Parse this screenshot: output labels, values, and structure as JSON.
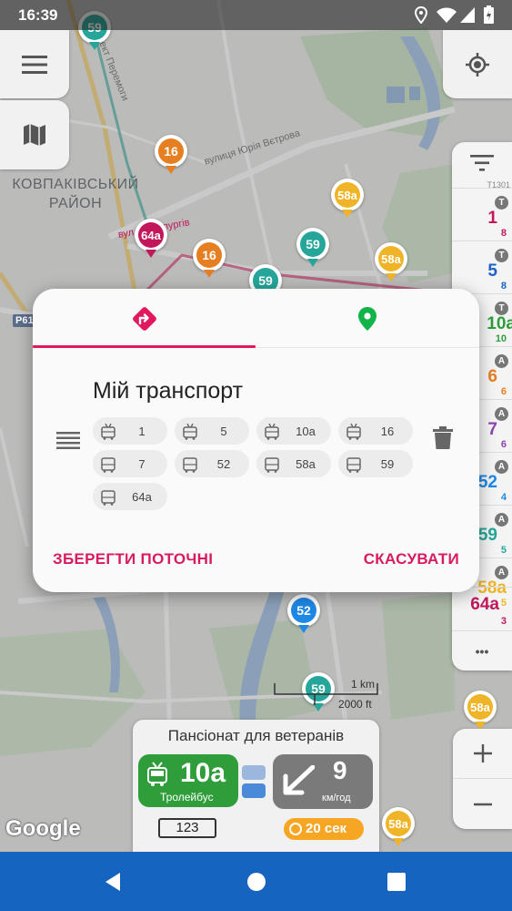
{
  "status_bar": {
    "time": "16:39"
  },
  "map": {
    "district_label": "КОВПАКІВСЬКИЙ\nРАЙОН",
    "street_yuria_vetrova": "вулиця Юрія Вєтрова",
    "street_peremohy": "ект Перемоги",
    "street_metalurhiv": "вул. Металургів",
    "road_code": "Р61",
    "scale_km": "1 km",
    "scale_ft": "2000 ft",
    "google_logo": "Google",
    "pins": [
      {
        "label": "59",
        "color": "#26a69a"
      },
      {
        "label": "16",
        "color": "#e67e22"
      },
      {
        "label": "58а",
        "color": "#f0b429"
      },
      {
        "label": "64а",
        "color": "#c2185b"
      },
      {
        "label": "16",
        "color": "#e67e22"
      },
      {
        "label": "59",
        "color": "#26a69a"
      },
      {
        "label": "58а",
        "color": "#f0b429"
      },
      {
        "label": "59",
        "color": "#26a69a"
      },
      {
        "label": "52",
        "color": "#1e88e5"
      },
      {
        "label": "59",
        "color": "#26a69a"
      },
      {
        "label": "58а",
        "color": "#f0b429"
      },
      {
        "label": "58а",
        "color": "#f0b429"
      }
    ]
  },
  "route_panel": {
    "rows": [
      {
        "num": "1",
        "badge": "T",
        "sub": "8",
        "color": "#c2185b"
      },
      {
        "num": "5",
        "badge": "T",
        "sub": "8",
        "color": "#1e63c6"
      },
      {
        "num": "10а",
        "badge": "T",
        "sub": "10",
        "color": "#2e9d3a"
      },
      {
        "num": "6",
        "badge": "A",
        "sub": "6",
        "color": "#e67e22"
      },
      {
        "num": "7",
        "badge": "A",
        "sub": "6",
        "color": "#8e44ad"
      },
      {
        "num": "52",
        "badge": "A",
        "sub": "4",
        "color": "#1e88e5"
      },
      {
        "num": "59",
        "badge": "A",
        "sub": "5",
        "color": "#26a69a"
      },
      {
        "num": "58а",
        "badge": "A",
        "sub": "5",
        "color": "#f0b429"
      },
      {
        "num": "64а",
        "badge": "A",
        "sub": "3",
        "color": "#c2185b"
      }
    ],
    "top_code": "T1301",
    "more_label": "•••"
  },
  "stop_card": {
    "stop_name": "Пансіонат для ветеранів",
    "route_number": "10а",
    "route_type": "Тролейбус",
    "plate": "123",
    "speed_value": "9",
    "speed_unit": "км/год",
    "eta": "20 сек"
  },
  "dialog": {
    "tabs": [
      {
        "name": "route-tab",
        "icon": "turn-right-icon",
        "active": true
      },
      {
        "name": "stops-tab",
        "icon": "location-pin-icon",
        "active": false
      }
    ],
    "title": "Мій транспорт",
    "chips": [
      {
        "type": "trolleybus",
        "label": "1"
      },
      {
        "type": "trolleybus",
        "label": "5"
      },
      {
        "type": "trolleybus",
        "label": "10а"
      },
      {
        "type": "trolleybus",
        "label": "16"
      },
      {
        "type": "bus",
        "label": "7"
      },
      {
        "type": "bus",
        "label": "52"
      },
      {
        "type": "bus",
        "label": "58а"
      },
      {
        "type": "bus",
        "label": "59"
      },
      {
        "type": "bus",
        "label": "64а"
      }
    ],
    "save_label": "ЗБЕРЕГТИ ПОТОЧНІ",
    "cancel_label": "СКАСУВАТИ"
  },
  "colors": {
    "accent": "#d81b60",
    "trolleybus_green": "#2e9d3a",
    "nav_bar": "#1565c0",
    "location_pin": "#14b34a"
  }
}
